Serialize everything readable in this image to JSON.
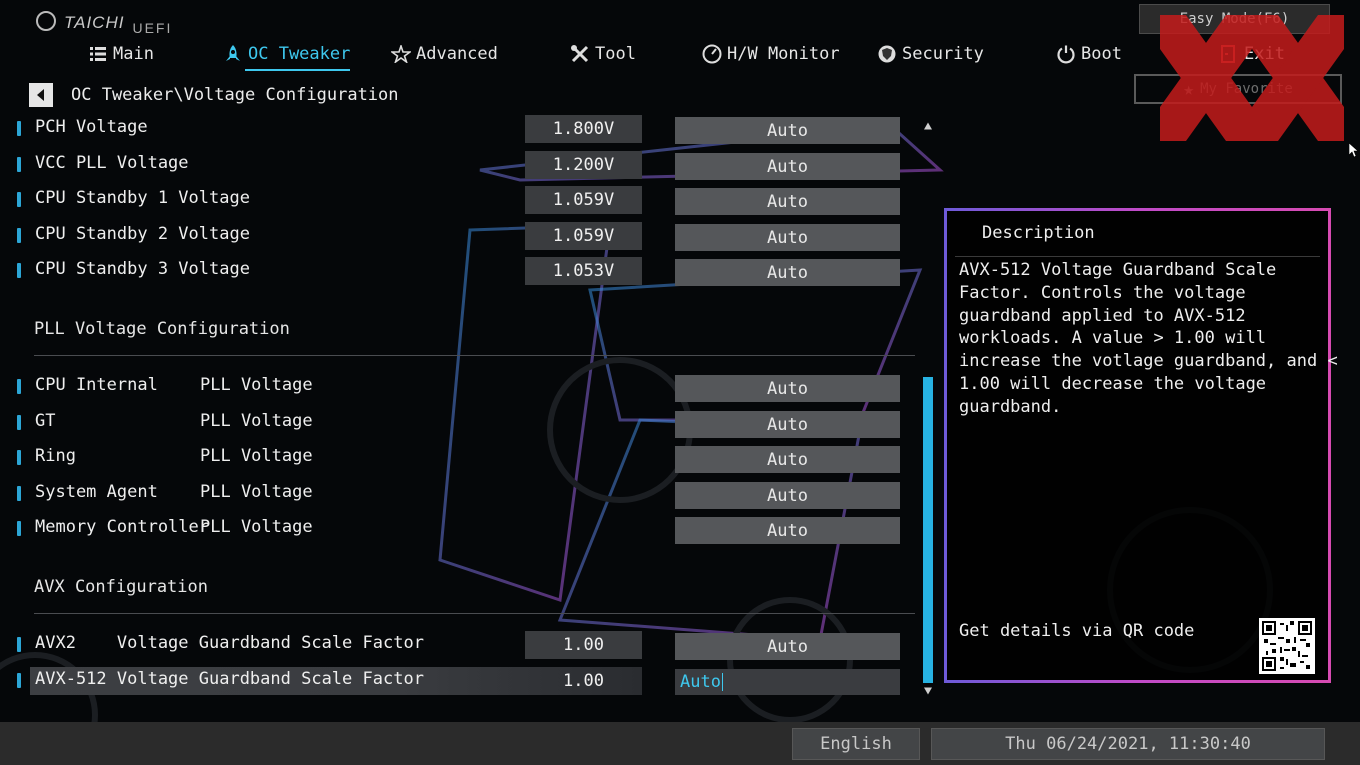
{
  "brand": {
    "name": "TAICHI",
    "sub": "UEFI"
  },
  "nav": {
    "items": [
      {
        "label": "Main",
        "icon": "list-icon"
      },
      {
        "label": "OC Tweaker",
        "icon": "rocket-icon"
      },
      {
        "label": "Advanced",
        "icon": "star-icon"
      },
      {
        "label": "Tool",
        "icon": "wrench-icon"
      },
      {
        "label": "H/W Monitor",
        "icon": "gauge-icon"
      },
      {
        "label": "Security",
        "icon": "shield-icon"
      },
      {
        "label": "Boot",
        "icon": "power-icon"
      },
      {
        "label": "Exit",
        "icon": "exit-icon"
      }
    ],
    "active": "OC Tweaker"
  },
  "easy_mode_label": "Easy Mode(F6)",
  "my_favorite_label": "My Favorite",
  "breadcrumb": "OC Tweaker\\Voltage Configuration",
  "voltage_rows": [
    {
      "label": "PCH Voltage",
      "value": "1.800V",
      "option": "Auto"
    },
    {
      "label": "VCC PLL Voltage",
      "value": "1.200V",
      "option": "Auto"
    },
    {
      "label": "CPU Standby 1 Voltage",
      "value": "1.059V",
      "option": "Auto"
    },
    {
      "label": "CPU Standby 2 Voltage",
      "value": "1.059V",
      "option": "Auto"
    },
    {
      "label": "CPU Standby 3 Voltage",
      "value": "1.053V",
      "option": "Auto"
    }
  ],
  "pll_section": {
    "title": "PLL Voltage Configuration",
    "rows": [
      {
        "label": "CPU Internal",
        "suffix": "PLL Voltage",
        "option": "Auto"
      },
      {
        "label": "GT",
        "suffix": "PLL Voltage",
        "option": "Auto"
      },
      {
        "label": "Ring",
        "suffix": "PLL Voltage",
        "option": "Auto"
      },
      {
        "label": "System Agent",
        "suffix": "PLL Voltage",
        "option": "Auto"
      },
      {
        "label": "Memory Controller",
        "suffix": "PLL Voltage",
        "option": "Auto"
      }
    ]
  },
  "avx_section": {
    "title": "AVX Configuration",
    "rows": [
      {
        "label": "AVX2    Voltage Guardband Scale Factor",
        "value": "1.00",
        "option": "Auto"
      },
      {
        "label": "AVX-512 Voltage Guardband Scale Factor",
        "value": "1.00",
        "option": "Auto"
      }
    ]
  },
  "scroll_position": 0.85,
  "description": {
    "title": "Description",
    "body": "AVX-512 Voltage Guardband Scale\nFactor. Controls the voltage\nguardband applied to AVX-512\nworkloads. A value > 1.00 will\nincrease the votlage guardband, and <\n1.00 will decrease the voltage\nguardband.",
    "qr_label": "Get details via QR code"
  },
  "status": {
    "language": "English",
    "datetime": "Thu 06/24/2021, 11:30:40"
  },
  "colors": {
    "accent": "#3ec8ee",
    "panel_border": "#c04bc8",
    "field_bg": "#55575a"
  }
}
